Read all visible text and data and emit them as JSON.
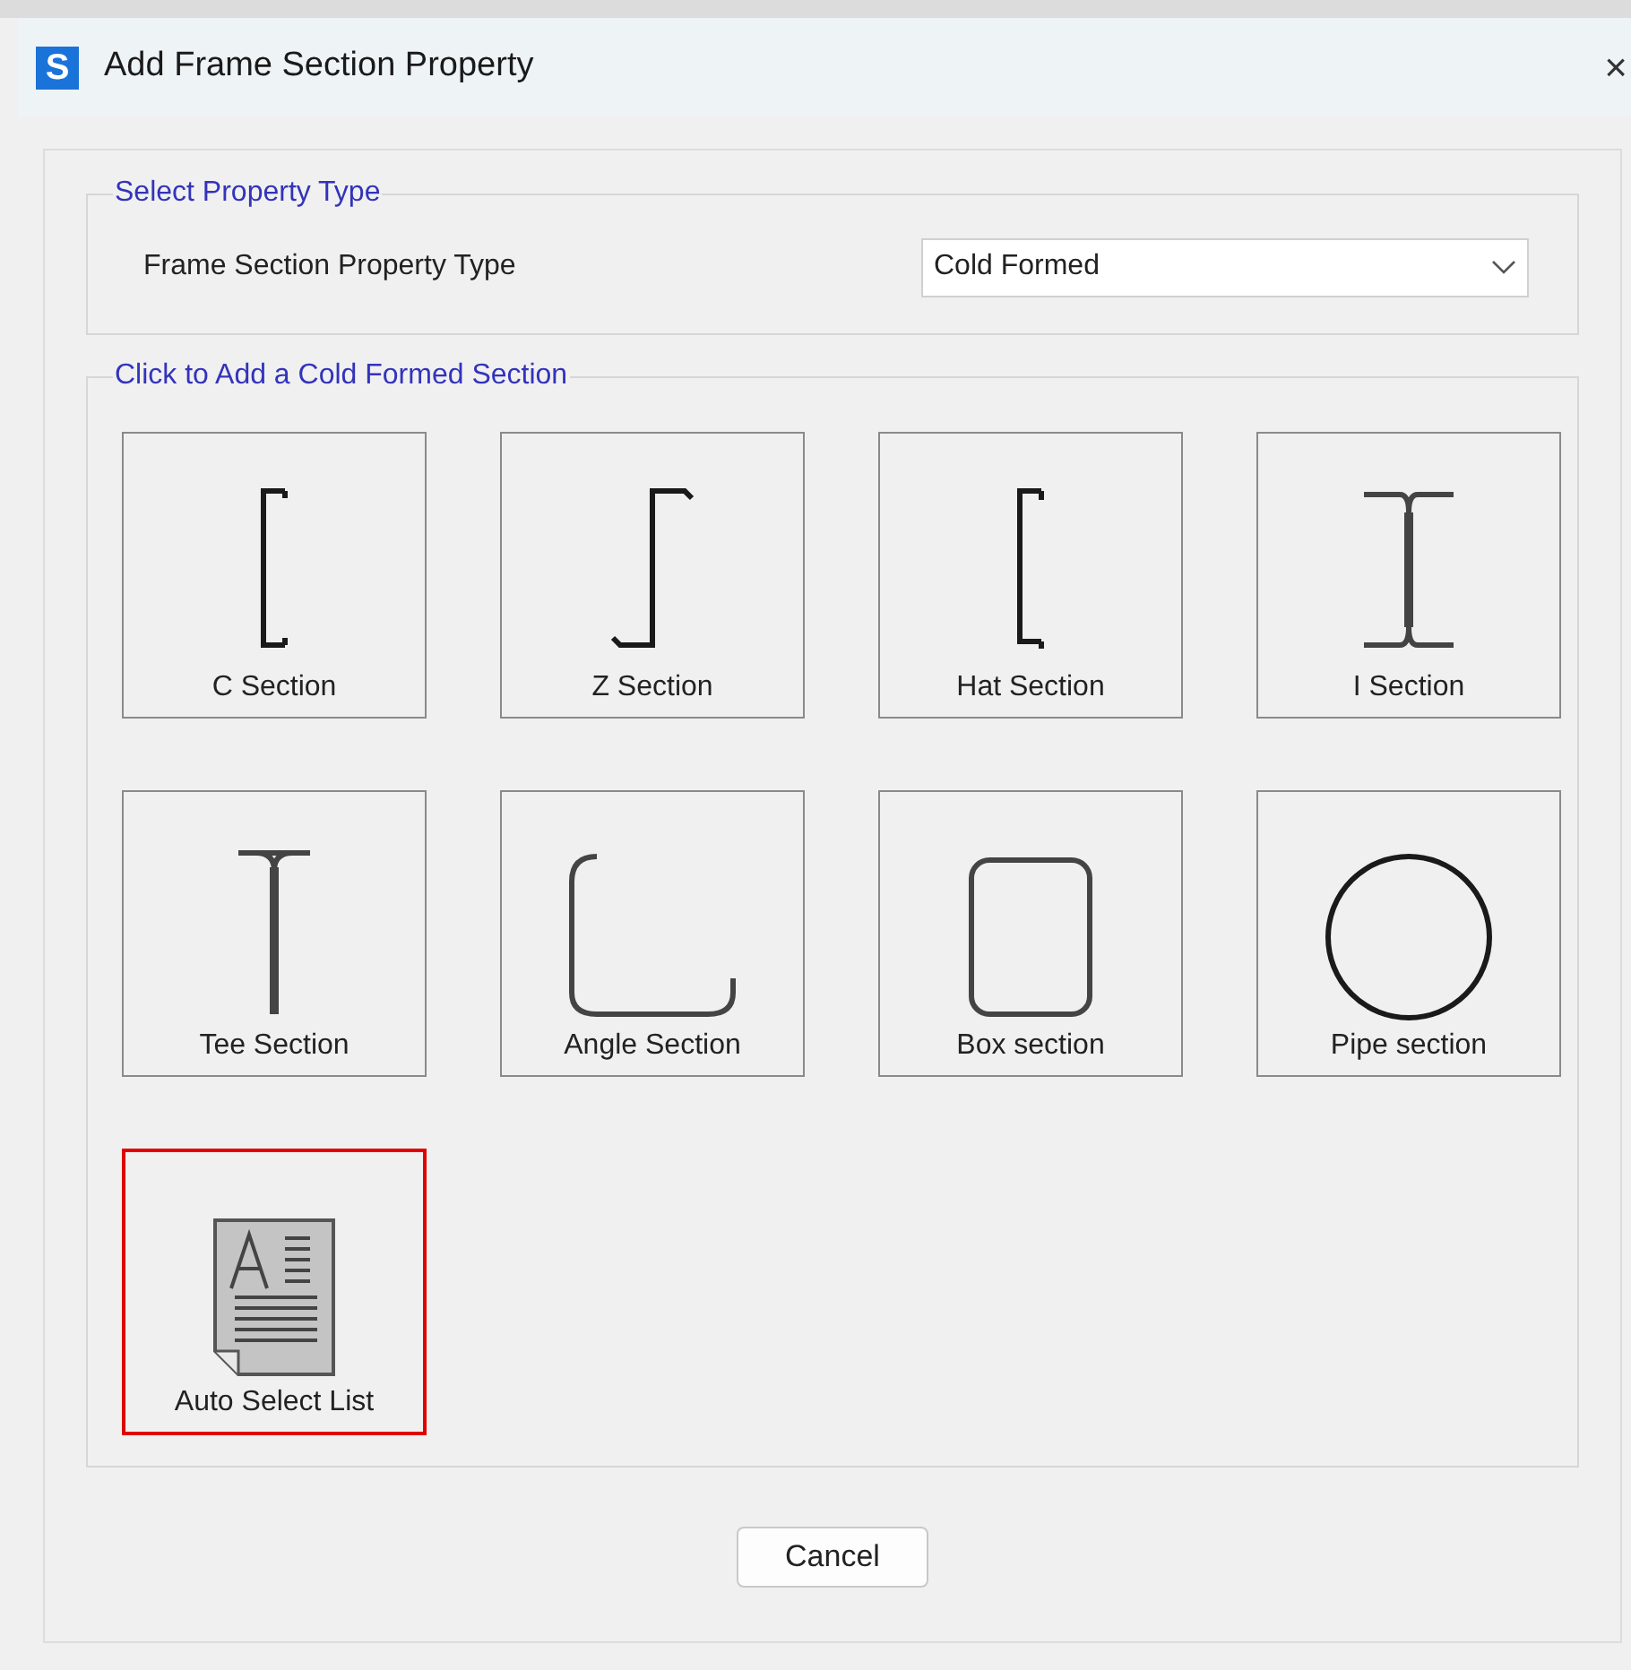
{
  "window": {
    "title": "Add Frame Section Property",
    "app_icon": "S",
    "close": "×"
  },
  "property_group": {
    "legend": "Select Property Type",
    "label": "Frame Section Property Type",
    "dropdown": {
      "value": "Cold Formed"
    }
  },
  "sections_group": {
    "legend": "Click to Add a Cold Formed Section",
    "items": [
      {
        "kind": "c",
        "label": "C Section",
        "selected": false
      },
      {
        "kind": "z",
        "label": "Z Section",
        "selected": false
      },
      {
        "kind": "hat",
        "label": "Hat Section",
        "selected": false
      },
      {
        "kind": "i",
        "label": "I Section",
        "selected": false
      },
      {
        "kind": "tee",
        "label": "Tee Section",
        "selected": false
      },
      {
        "kind": "angle",
        "label": "Angle Section",
        "selected": false
      },
      {
        "kind": "box",
        "label": "Box section",
        "selected": false
      },
      {
        "kind": "pipe",
        "label": "Pipe section",
        "selected": false
      },
      {
        "kind": "list",
        "label": "Auto Select List",
        "selected": true
      }
    ]
  },
  "buttons": [
    {
      "label": "Cancel"
    }
  ]
}
